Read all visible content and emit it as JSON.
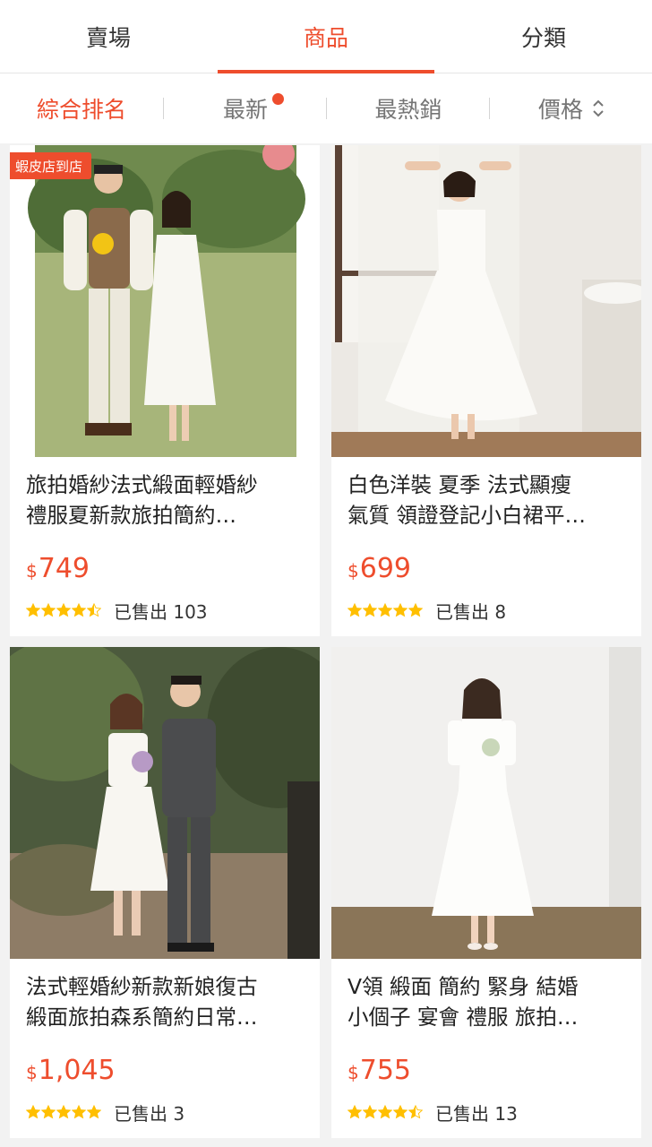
{
  "top_tabs": [
    {
      "label": "賣場",
      "active": false
    },
    {
      "label": "商品",
      "active": true
    },
    {
      "label": "分類",
      "active": false
    }
  ],
  "sort_bar": {
    "items": [
      {
        "label": "綜合排名",
        "active": true
      },
      {
        "label": "最新",
        "active": false
      },
      {
        "label": "最熱銷",
        "active": false
      },
      {
        "label": "價格",
        "active": false
      }
    ],
    "new_indicator_color": "#ee4d2d",
    "price_sort_icon": "sort-updown-icon"
  },
  "accent_color": "#ee4d2d",
  "products": [
    {
      "badge": "蝦皮店到店",
      "title_lines": [
        "旅拍婚紗法式緞面輕婚紗",
        "禮服夏新款旅拍簡約…"
      ],
      "currency": "$",
      "price": "749",
      "rating": 4.5,
      "sold": "已售出 103",
      "image_icon": "couple-photo"
    },
    {
      "badge": "",
      "title_lines": [
        "白色洋裝 夏季 法式顯瘦",
        "氣質 領證登記小白裙平…"
      ],
      "currency": "$",
      "price": "699",
      "rating": 5,
      "sold": "已售出 8",
      "image_icon": "dress-photo"
    },
    {
      "badge": "",
      "title_lines": [
        "法式輕婚紗新款新娘復古",
        "緞面旅拍森系簡約日常…"
      ],
      "currency": "$",
      "price": "1,045",
      "rating": 5,
      "sold": "已售出 3",
      "image_icon": "couple-photo"
    },
    {
      "badge": "",
      "title_lines": [
        "V領 緞面 簡約 緊身 結婚",
        "小個子 宴會 禮服 旅拍…"
      ],
      "currency": "$",
      "price": "755",
      "rating": 4.5,
      "sold": "已售出 13",
      "image_icon": "dress-photo"
    }
  ]
}
